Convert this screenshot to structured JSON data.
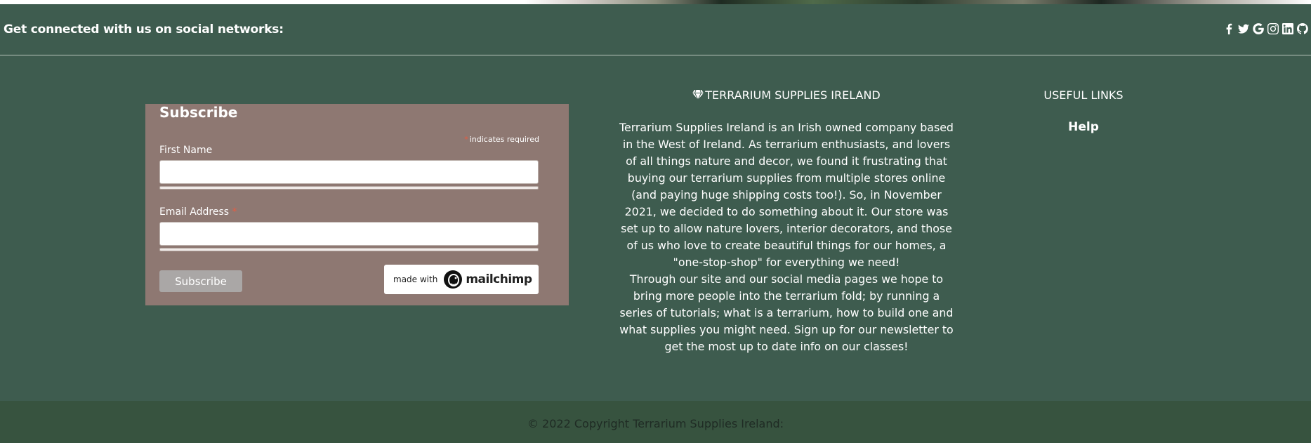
{
  "social": {
    "text": "Get connected with us on social networks:",
    "icons": [
      "facebook-icon",
      "twitter-icon",
      "google-icon",
      "instagram-icon",
      "linkedin-icon",
      "github-icon"
    ]
  },
  "subscribe": {
    "title": "Subscribe",
    "required_note": "indicates required",
    "required_mark": "*",
    "first_name_label": "First Name",
    "first_name_value": "",
    "email_label": "Email Address",
    "email_value": "",
    "button_label": "Subscribe",
    "badge_made_with": "made with",
    "badge_brand": "mailchimp"
  },
  "about": {
    "title": "TERRARIUM SUPPLIES IRELAND",
    "paragraph1": "Terrarium Supplies Ireland is an Irish owned company based in the West of Ireland. As terrarium enthusiasts, and lovers of all things nature and decor, we found it frustrating that buying our terrarium supplies from multiple stores online (and paying huge shipping costs too!). So, in November 2021, we decided to do something about it. Our store was set up to allow nature lovers, interior decorators, and those of us who love to create beautiful things for our homes, a \"one-stop-shop\" for everything we need!",
    "paragraph2": "Through our site and our social media pages we hope to bring more people into the terrarium fold; by running a series of tutorials; what is a terrarium, how to build one and what supplies you might need. Sign up for our newsletter to get the most up to date info on our classes!"
  },
  "links": {
    "title": "USEFUL LINKS",
    "items": [
      {
        "label": "Help"
      }
    ]
  },
  "footer": {
    "copyright": "© 2022 Copyright Terrarium Supplies Ireland:"
  },
  "colors": {
    "background": "#3e5c4f",
    "form_background": "#8e7872",
    "copyright_background": "#37533f",
    "required_star": "#e85c41"
  }
}
